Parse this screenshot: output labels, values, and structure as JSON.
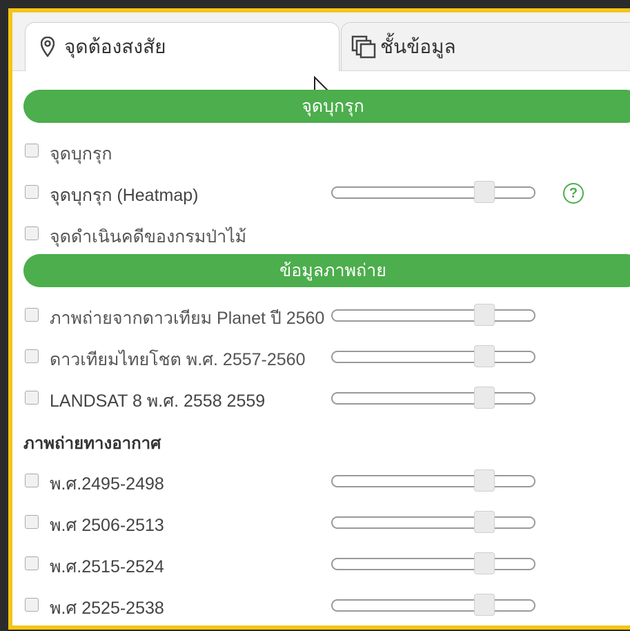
{
  "tabs": [
    {
      "label": "จุดต้องสงสัย",
      "icon": "map-pin-icon",
      "active": true
    },
    {
      "label": "ชั้นข้อมูล",
      "icon": "layers-icon",
      "active": false
    }
  ],
  "sections": {
    "encroachment": {
      "title": "จุดบุกรุก",
      "items": [
        {
          "label": "จุดบุกรุก",
          "checked": false
        },
        {
          "label": "จุดบุกรุก (Heatmap)",
          "checked": false,
          "opacity": 0.75,
          "help": "?"
        },
        {
          "label": "จุดดำเนินคดีของกรมป่าไม้",
          "checked": false
        }
      ]
    },
    "imagery": {
      "title": "ข้อมูลภาพถ่าย",
      "items": [
        {
          "label": "ภาพถ่ายจากดาวเทียม Planet ปี 2560",
          "checked": false,
          "opacity": 0.75
        },
        {
          "label": "ดาวเทียมไทยโชต พ.ศ. 2557-2560",
          "checked": false,
          "opacity": 0.75
        },
        {
          "label": "LANDSAT 8 พ.ศ. 2558 2559",
          "checked": false,
          "opacity": 0.75
        }
      ]
    },
    "aerial": {
      "title": "ภาพถ่ายทางอากาศ",
      "items": [
        {
          "label": "พ.ศ.2495-2498",
          "checked": false,
          "opacity": 0.75
        },
        {
          "label": "พ.ศ 2506-2513",
          "checked": false,
          "opacity": 0.75
        },
        {
          "label": "พ.ศ.2515-2524",
          "checked": false,
          "opacity": 0.75
        },
        {
          "label": "พ.ศ 2525-2538",
          "checked": false,
          "opacity": 0.75
        }
      ]
    }
  },
  "colors": {
    "accent": "#4cae4c",
    "frame": "#f5c518",
    "background": "#2b2b2b"
  }
}
